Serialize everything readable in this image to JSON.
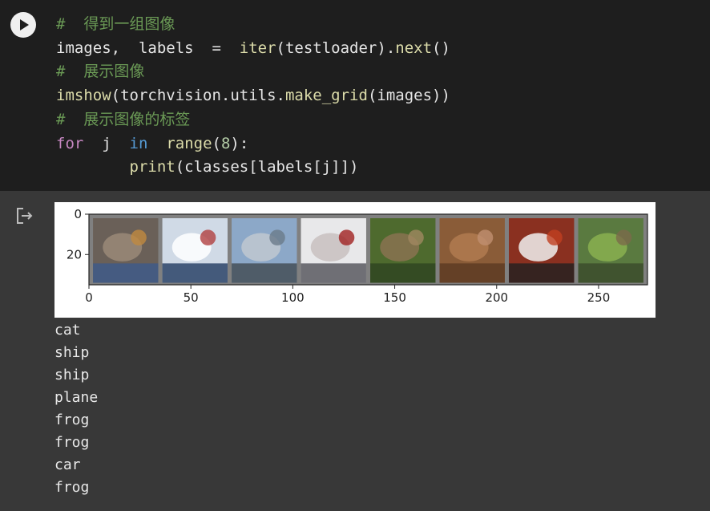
{
  "code_cell": {
    "lines": [
      [
        {
          "t": "#  得到一组图像",
          "c": "c-comment"
        }
      ],
      [
        {
          "t": "images,  labels  =  ",
          "c": "c-ident"
        },
        {
          "t": "iter",
          "c": "c-fn"
        },
        {
          "t": "(testloader).",
          "c": "c-ident"
        },
        {
          "t": "next",
          "c": "c-fn"
        },
        {
          "t": "()",
          "c": "c-ident"
        }
      ],
      [
        {
          "t": "#  展示图像",
          "c": "c-comment"
        }
      ],
      [
        {
          "t": "imshow",
          "c": "c-fn"
        },
        {
          "t": "(torchvision.utils.",
          "c": "c-ident"
        },
        {
          "t": "make_grid",
          "c": "c-fn"
        },
        {
          "t": "(images))",
          "c": "c-ident"
        }
      ],
      [
        {
          "t": "#  展示图像的标签",
          "c": "c-comment"
        }
      ],
      [
        {
          "t": "for",
          "c": "c-kw"
        },
        {
          "t": "  j  ",
          "c": "c-ident"
        },
        {
          "t": "in",
          "c": "c-kw2"
        },
        {
          "t": "  ",
          "c": "c-ident"
        },
        {
          "t": "range",
          "c": "c-fn"
        },
        {
          "t": "(",
          "c": "c-ident"
        },
        {
          "t": "8",
          "c": "c-num"
        },
        {
          "t": "):",
          "c": "c-ident"
        }
      ],
      [
        {
          "t": "        ",
          "c": "c-ident"
        },
        {
          "t": "print",
          "c": "c-fn"
        },
        {
          "t": "(classes[labels[j]])",
          "c": "c-ident"
        }
      ]
    ]
  },
  "colors": {
    "code_bg": "#1e1e1e",
    "output_bg": "#383838",
    "comment": "#6a9955",
    "keyword": "#c586c0",
    "function": "#dcdcaa"
  },
  "icons": {
    "run": "play-icon",
    "output": "output-redirect-icon"
  },
  "figure": {
    "x_ticks": [
      "0",
      "50",
      "100",
      "150",
      "200",
      "250"
    ],
    "y_ticks": [
      "0",
      "20"
    ],
    "tiles": [
      {
        "name": "cat",
        "colors": [
          "#6a6058",
          "#9a8a78",
          "#3c5a8c",
          "#c08a40"
        ]
      },
      {
        "name": "ship",
        "colors": [
          "#d0dae6",
          "#ffffff",
          "#203a60",
          "#b04040"
        ]
      },
      {
        "name": "ship",
        "colors": [
          "#8ca8c8",
          "#c0c8d0",
          "#404850",
          "#6a7a8a"
        ]
      },
      {
        "name": "plane",
        "colors": [
          "#e8e8ea",
          "#c8c0c0",
          "#505058",
          "#a02020"
        ]
      },
      {
        "name": "frog",
        "colors": [
          "#4e6a2e",
          "#8a7250",
          "#2e4420",
          "#a08860"
        ]
      },
      {
        "name": "frog",
        "colors": [
          "#8a5c38",
          "#b07a50",
          "#5a3a22",
          "#c09070"
        ]
      },
      {
        "name": "car",
        "colors": [
          "#8a3020",
          "#f0f0f0",
          "#202020",
          "#c04020"
        ]
      },
      {
        "name": "frog",
        "colors": [
          "#5a7a40",
          "#8ab050",
          "#3a4a2a",
          "#7a6a4a"
        ]
      }
    ]
  },
  "stdout": [
    "cat",
    "ship",
    "ship",
    "plane",
    "frog",
    "frog",
    "car",
    "frog"
  ]
}
